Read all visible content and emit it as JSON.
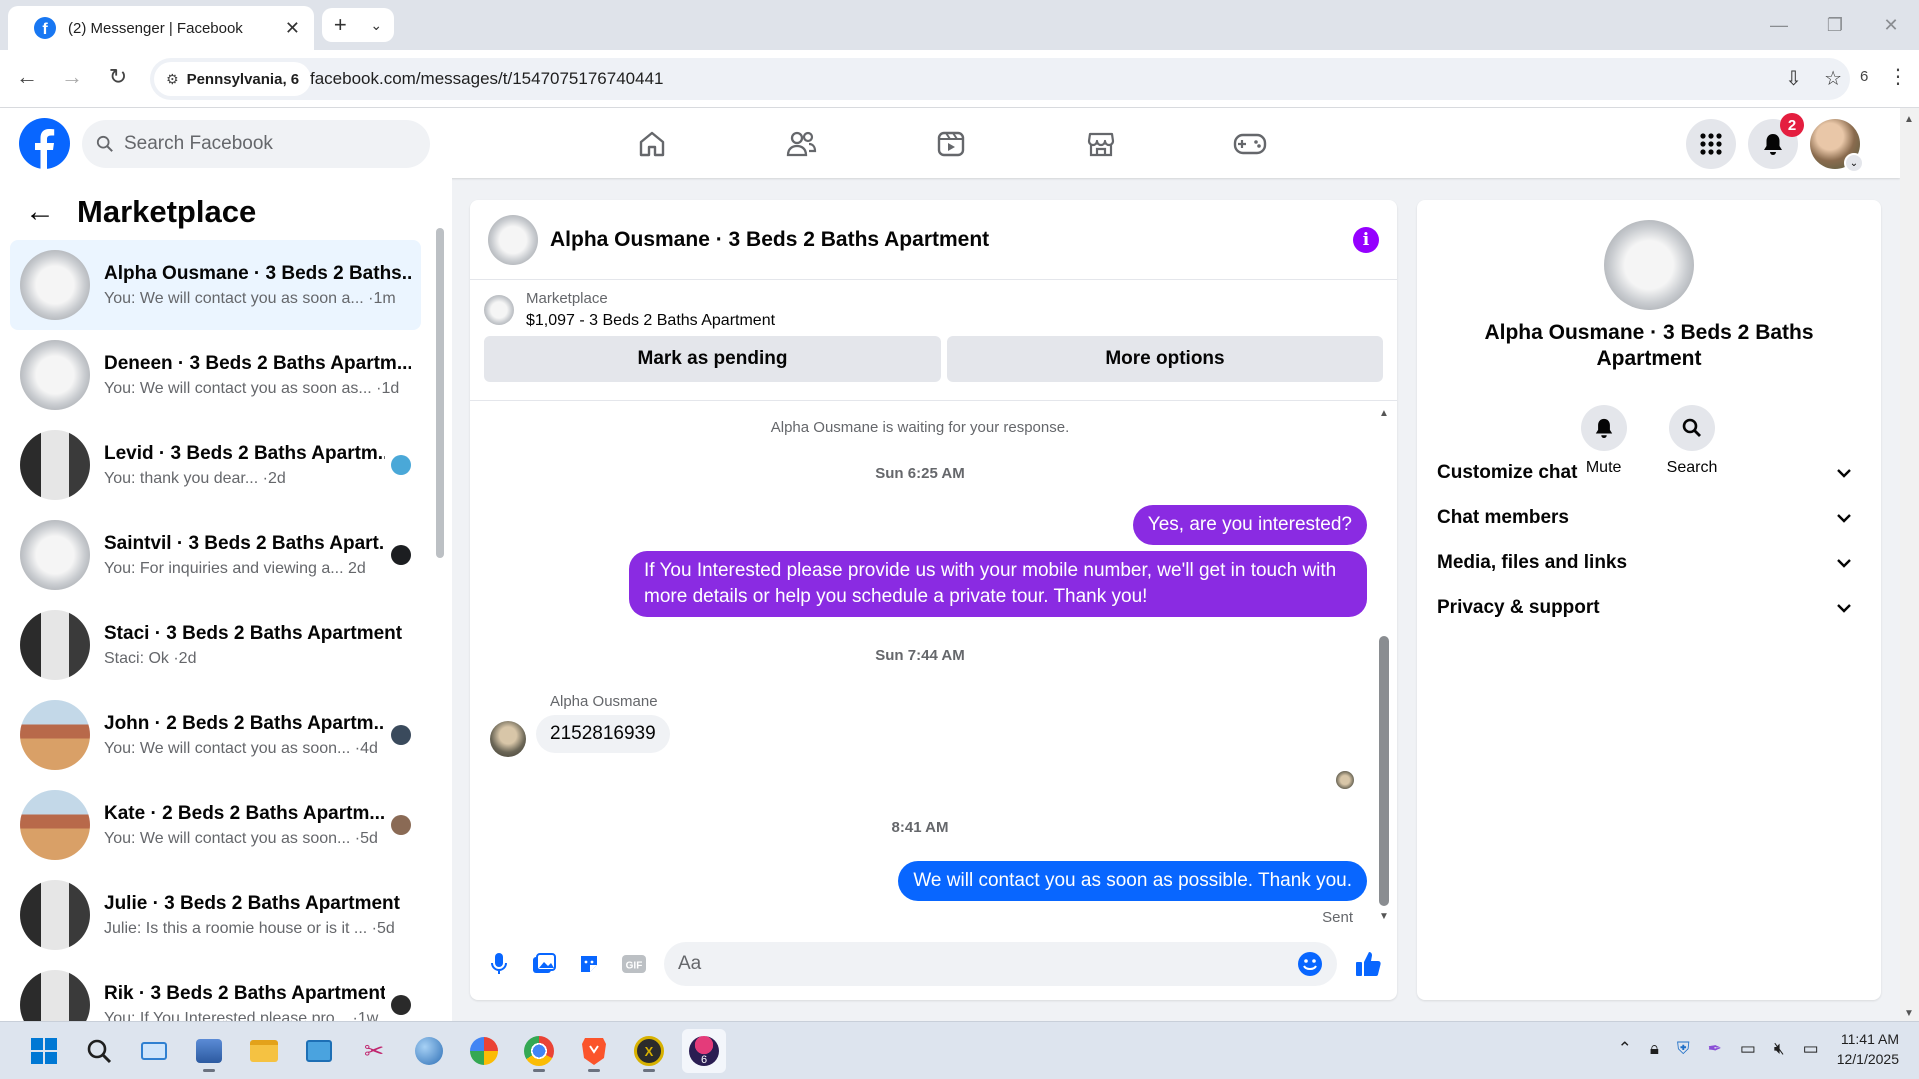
{
  "browser": {
    "tab_title": "(2) Messenger | Facebook",
    "tab_close": "✕",
    "site_chip": "Pennsylvania, 6",
    "url": "facebook.com/messages/t/1547075176740441",
    "extensions_count": "6"
  },
  "fb_header": {
    "search_placeholder": "Search Facebook",
    "notifications_count": "2",
    "nav_icons": [
      "home-icon",
      "friends-icon",
      "video-icon",
      "marketplace-icon",
      "gaming-icon"
    ]
  },
  "sidebar": {
    "title": "Marketplace",
    "conversations": [
      {
        "name": "Alpha Ousmane · 3 Beds 2 Baths...",
        "preview": "You: We will contact you as soon a... ·1m",
        "thumb": "th-kitchen",
        "active": true,
        "mini": ""
      },
      {
        "name": "Deneen · 3 Beds 2 Baths Apartm...",
        "preview": "You: We will contact you as soon as... ·1d",
        "thumb": "th-kitchen",
        "active": false,
        "mini": ""
      },
      {
        "name": "Levid · 3 Beds 2 Baths Apartm...",
        "preview": "You: thank you dear... ·2d",
        "thumb": "th-dark",
        "active": false,
        "mini": "#4aa8d8"
      },
      {
        "name": "Saintvil · 3 Beds 2 Baths Apart...",
        "preview": "You: For inquiries and viewing a...   2d",
        "thumb": "th-kitchen",
        "active": false,
        "mini": "#1c1e21"
      },
      {
        "name": "Staci · 3 Beds 2 Baths Apartment",
        "preview": "Staci: Ok ·2d",
        "thumb": "th-dark",
        "active": false,
        "mini": ""
      },
      {
        "name": "John · 2 Beds 2 Baths Apartm...",
        "preview": "You: We will contact you as soon... ·4d",
        "thumb": "th-wood",
        "active": false,
        "mini": "#3a4a5c"
      },
      {
        "name": "Kate · 2 Beds 2 Baths Apartm...",
        "preview": "You: We will contact you as soon... ·5d",
        "thumb": "th-wood",
        "active": false,
        "mini": "#8a6a55"
      },
      {
        "name": "Julie · 3 Beds 2 Baths Apartment",
        "preview": "Julie: Is this a roomie house or is it ... ·5d",
        "thumb": "th-dark",
        "active": false,
        "mini": ""
      },
      {
        "name": "Rik · 3 Beds 2 Baths Apartment",
        "preview": "You: If You Interested please pro... ·1w",
        "thumb": "th-dark",
        "active": false,
        "mini": "#2a2a2a"
      }
    ]
  },
  "chat": {
    "title": "Alpha Ousmane · 3 Beds 2 Baths Apartment",
    "listing_source": "Marketplace",
    "listing_price_title": "$1,097 - 3 Beds 2 Baths Apartment",
    "mark_pending_label": "Mark as pending",
    "more_options_label": "More options",
    "waiting_note": "Alpha Ousmane is waiting for your response.",
    "timestamp_1": "Sun 6:25 AM",
    "msg_out_1": "Yes, are you interested?",
    "msg_out_2": "If You Interested please provide us with your mobile number, we'll get in touch with more details or help you schedule a private tour. Thank you!",
    "timestamp_2": "Sun 7:44 AM",
    "sender_name": "Alpha Ousmane",
    "msg_in_1": "2152816939",
    "timestamp_3": "8:41 AM",
    "msg_out_3": "We will contact you as soon as possible. Thank you.",
    "sent_status": "Sent",
    "composer_placeholder": "Aa"
  },
  "info_panel": {
    "name": "Alpha Ousmane · 3 Beds 2 Baths Apartment",
    "mute_label": "Mute",
    "search_label": "Search",
    "sections": [
      "Customize chat",
      "Chat members",
      "Media, files and links",
      "Privacy & support"
    ]
  },
  "taskbar": {
    "time": "11:41 AM",
    "date": "12/1/2025"
  },
  "colors": {
    "fb_blue": "#0866ff",
    "purple_bubble": "#8a2be2",
    "badge_red": "#e41e3f"
  }
}
